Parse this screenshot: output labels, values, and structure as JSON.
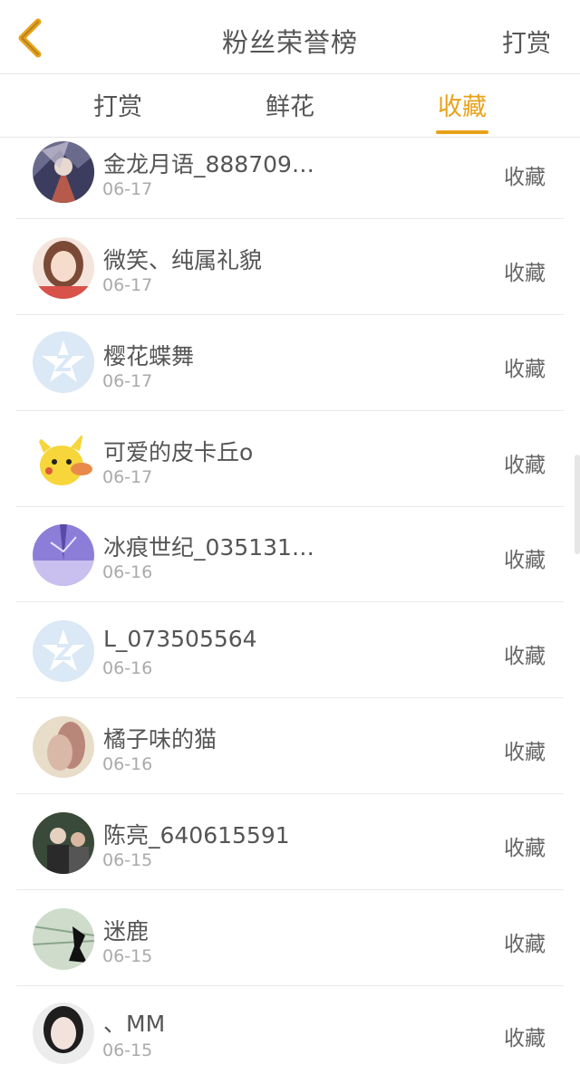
{
  "header": {
    "title": "粉丝荣誉榜",
    "action_label": "打赏",
    "back_icon": "chevron-left-icon",
    "accent_color": "#e8a21a"
  },
  "tabs": [
    {
      "label": "打赏",
      "active": false
    },
    {
      "label": "鲜花",
      "active": false
    },
    {
      "label": "收藏",
      "active": true
    }
  ],
  "list": {
    "items": [
      {
        "name": "金龙月语_888709…",
        "date": "06-17",
        "action": "收藏",
        "avatar": "photo-anime"
      },
      {
        "name": "微笑、纯属礼貌",
        "date": "06-17",
        "action": "收藏",
        "avatar": "photo-girl"
      },
      {
        "name": "樱花蝶舞",
        "date": "06-17",
        "action": "收藏",
        "avatar": "default-star-icon"
      },
      {
        "name": "可爱的皮卡丘o",
        "date": "06-17",
        "action": "收藏",
        "avatar": "pikachu"
      },
      {
        "name": "冰痕世纪_035131…",
        "date": "06-16",
        "action": "收藏",
        "avatar": "photo-winter"
      },
      {
        "name": "L_073505564",
        "date": "06-16",
        "action": "收藏",
        "avatar": "default-star-icon"
      },
      {
        "name": "橘子味的猫",
        "date": "06-16",
        "action": "收藏",
        "avatar": "photo-girl-2"
      },
      {
        "name": "陈亮_640615591",
        "date": "06-15",
        "action": "收藏",
        "avatar": "photo-people"
      },
      {
        "name": "迷鹿",
        "date": "06-15",
        "action": "收藏",
        "avatar": "photo-map"
      },
      {
        "name": "、MM",
        "date": "06-15",
        "action": "收藏",
        "avatar": "photo-portrait"
      }
    ]
  }
}
